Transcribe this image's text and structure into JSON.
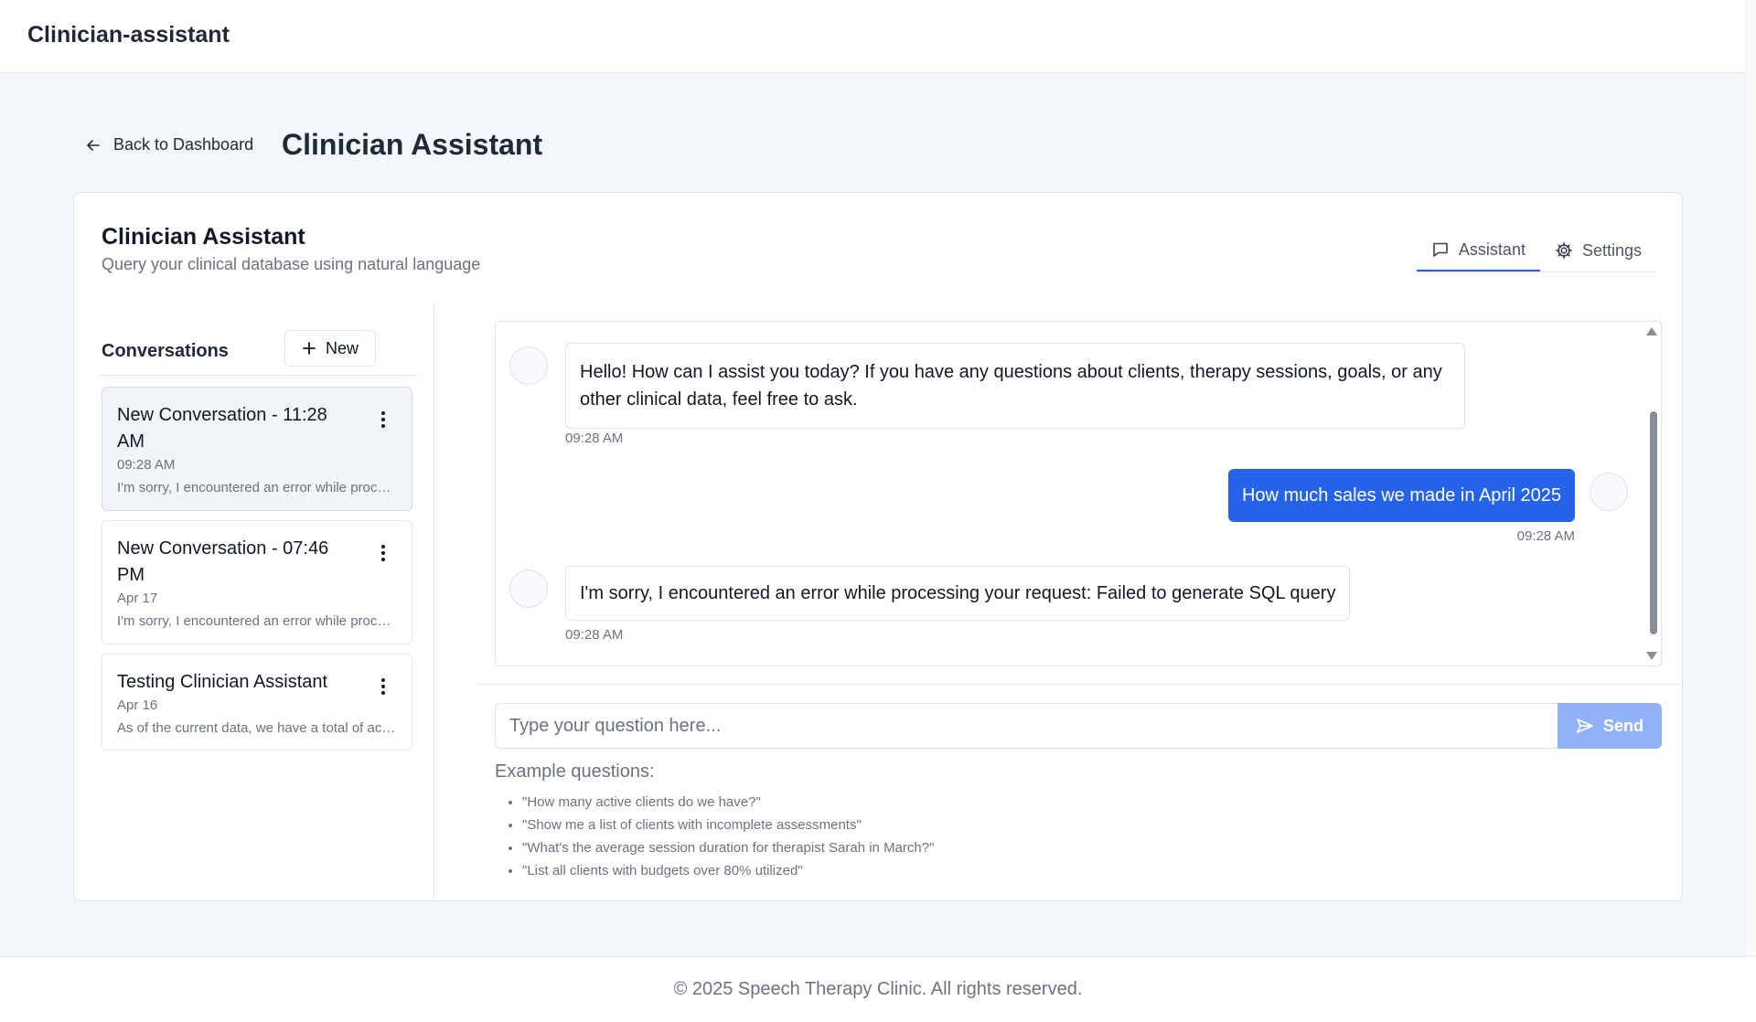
{
  "app": {
    "title": "Clinician-assistant"
  },
  "nav": {
    "back_label": "Back to Dashboard",
    "back_icon": "arrow-left-icon"
  },
  "page": {
    "title": "Clinician Assistant"
  },
  "card": {
    "title": "Clinician Assistant",
    "subtitle": "Query your clinical database using natural language"
  },
  "tabs": [
    {
      "label": "Assistant",
      "icon": "chat-bubble-icon",
      "active": true
    },
    {
      "label": "Settings",
      "icon": "gear-icon",
      "active": false
    }
  ],
  "sidebar": {
    "heading": "Conversations",
    "new_label": "New",
    "conversations": [
      {
        "title": "New Conversation - 11:28 AM",
        "time": "09:28 AM",
        "preview": "I'm sorry, I encountered an error while processing your request: Failed to generate SQL query",
        "active": true
      },
      {
        "title": "New Conversation - 07:46 PM",
        "time": "Apr 17",
        "preview": "I'm sorry, I encountered an error while processing your request",
        "active": false
      },
      {
        "title": "Testing Clinician Assistant",
        "time": "Apr 16",
        "preview": "As of the current data, we have a total of active clients",
        "active": false
      }
    ]
  },
  "chat": {
    "messages": [
      {
        "role": "assistant",
        "text": "Hello! How can I assist you today? If you have any questions about clients, therapy sessions, goals, or any other clinical data, feel free to ask.",
        "time": "09:28 AM"
      },
      {
        "role": "user",
        "text": "How much sales we made in April 2025",
        "time": "09:28 AM"
      },
      {
        "role": "assistant",
        "text": "I'm sorry, I encountered an error while processing your request: Failed to generate SQL query",
        "time": "09:28 AM"
      }
    ]
  },
  "input": {
    "placeholder": "Type your question here...",
    "value": "",
    "send_label": "Send",
    "send_icon": "send-icon"
  },
  "examples": {
    "heading": "Example questions:",
    "items": [
      "\"How many active clients do we have?\"",
      "\"Show me a list of clients with incomplete assessments\"",
      "\"What's the average session duration for therapist Sarah in March?\"",
      "\"List all clients with budgets over 80% utilized\""
    ]
  },
  "footer": {
    "text": "© 2025 Speech Therapy Clinic. All rights reserved."
  },
  "colors": {
    "accent": "#2563eb",
    "send_disabled": "#8fb3f5",
    "page_bg": "#f3f6fa"
  }
}
